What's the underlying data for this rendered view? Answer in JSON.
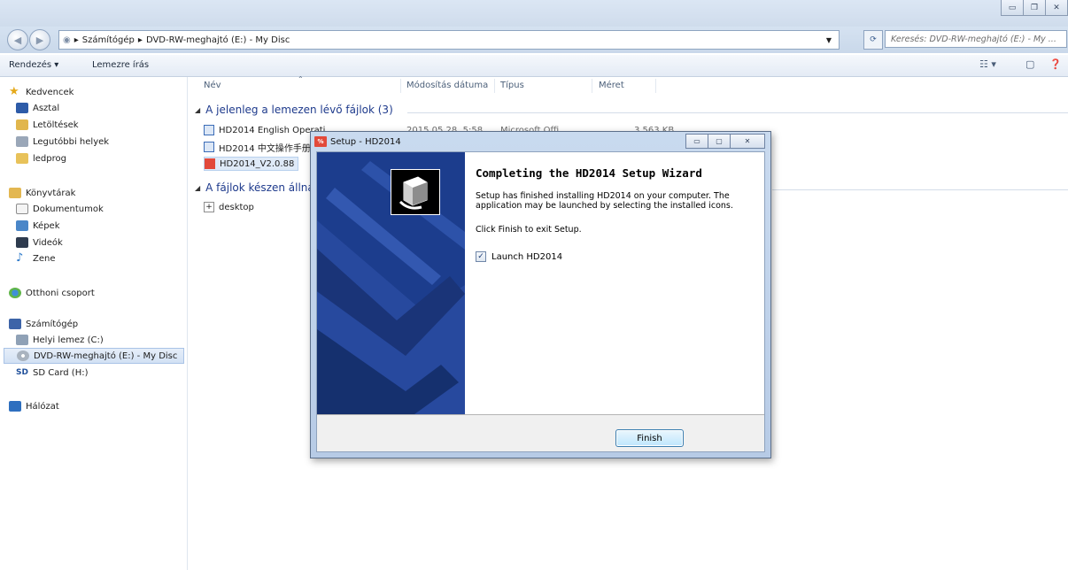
{
  "explorer": {
    "address": {
      "root_icon": "computer-icon",
      "crumbs": [
        "Számítógép",
        "DVD-RW-meghajtó (E:) - My Disc"
      ]
    },
    "search_placeholder": "Keresés: DVD-RW-meghajtó (E:) - My ...",
    "toolbar": {
      "organize": "Rendezés ▾",
      "burn": "Lemezre írás"
    },
    "nav": {
      "favorites": "Kedvencek",
      "desktop": "Asztal",
      "downloads": "Letöltések",
      "recent": "Legutóbbi helyek",
      "ledprog": "ledprog",
      "libraries": "Könyvtárak",
      "documents": "Dokumentumok",
      "pictures": "Képek",
      "videos": "Videók",
      "music": "Zene",
      "homegroup": "Otthoni csoport",
      "computer": "Számítógép",
      "local_disk": "Helyi lemez (C:)",
      "dvd": "DVD-RW-meghajtó (E:) - My Disc",
      "sd": "SD Card (H:)",
      "network": "Hálózat"
    },
    "columns": {
      "name": "Név",
      "modified": "Módosítás dátuma",
      "type": "Típus",
      "size": "Méret"
    },
    "groups": {
      "on_disc": "A jelenleg a lemezen lévő fájlok (3)",
      "to_write": "A fájlok készen állna"
    },
    "files": [
      {
        "name": "HD2014 English Operati",
        "date": "2015.05.28. 5:58",
        "type": "Microsoft Offi",
        "size": "3 563 KB"
      },
      {
        "name": "HD2014 中文操作手册"
      },
      {
        "name": "HD2014_V2.0.88"
      }
    ],
    "pending": [
      {
        "name": "desktop"
      }
    ]
  },
  "dialog": {
    "title": "Setup - HD2014",
    "app_icon_text": "%",
    "heading": "Completing the HD2014 Setup Wizard",
    "body1": "Setup has finished installing HD2014 on your computer. The application may be launched by selecting the installed icons.",
    "body2": "Click Finish to exit Setup.",
    "launch_label": "Launch HD2014",
    "launch_checked": true,
    "finish_label": "Finish"
  },
  "colors": {
    "banner": "#1c3d8d",
    "group_heading": "#1e3a8c",
    "app_icon": "#e2493a"
  }
}
